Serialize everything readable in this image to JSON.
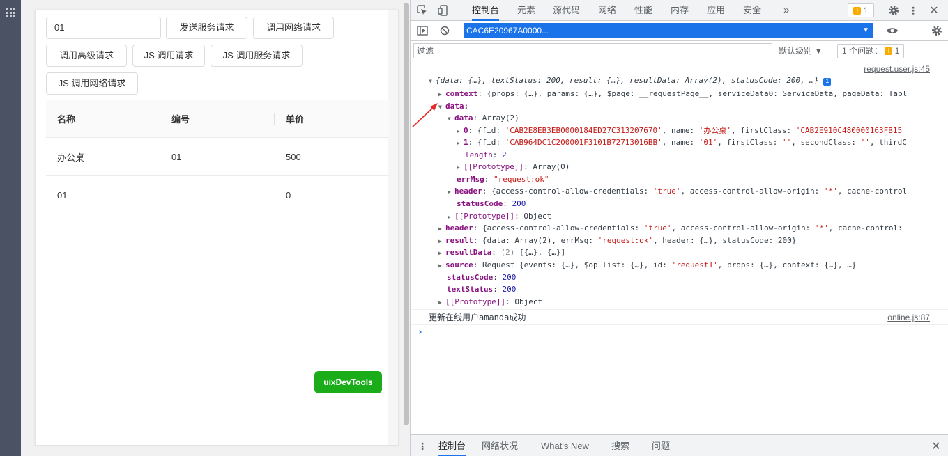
{
  "preview": {
    "input_value": "01",
    "buttons": [
      "发送服务请求",
      "调用网络请求",
      "调用高级请求",
      "JS 调用请求",
      "JS 调用服务请求",
      "JS 调用网络请求"
    ],
    "table": {
      "headers": [
        "名称",
        "编号",
        "单价"
      ],
      "rows": [
        [
          "办公桌",
          "01",
          "500"
        ],
        [
          "01",
          "",
          "0"
        ]
      ]
    },
    "uix_label": "uixDevTools"
  },
  "devtools": {
    "tabs": [
      "控制台",
      "元素",
      "源代码",
      "网络",
      "性能",
      "内存",
      "应用",
      "安全"
    ],
    "more": "»",
    "issue_badge_count": "1",
    "context": "CAC6E20967A0000...",
    "filter_placeholder": "过滤",
    "level": "默认级别 ▼",
    "issues_label": "1 个问题：",
    "issues_count": "1",
    "drawer_tabs": [
      "控制台",
      "网络状况",
      "What's New",
      "搜索",
      "问题"
    ],
    "console": {
      "src1": "request.user.js:45",
      "summary": "{data: {…}, textStatus: 200, result: {…}, resultData: Array(2), statusCode: 200, …}",
      "context_line": "{props: {…}, params: {…}, $page: __requestPage__, serviceData0: ServiceData, pageData: Tabl",
      "data_key": "data:",
      "array_val": "Array(2)",
      "item0_pre": "{fid: ",
      "item0_fid": "'CAB2E8EB3EB0000184ED27C313207670'",
      "item0_mid": ", name: ",
      "item0_name": "'办公桌'",
      "item0_post": ", firstClass: ",
      "item0_fc": "'CAB2E910C480000163FB15",
      "item1_pre": "{fid: ",
      "item1_fid": "'CAB964DC1C200001F3101B72713016BB'",
      "item1_mid": ", name: ",
      "item1_name": "'01'",
      "item1_post": ", firstClass: ",
      "item1_fc": "''",
      "item1_sc_pre": ", secondClass: ",
      "item1_sc": "''",
      "item1_tail": ", thirdC",
      "length_val": "2",
      "proto_array": "Array(0)",
      "errmsg_val": "\"request:ok\"",
      "header_pre": "{access-control-allow-credentials: ",
      "header_true": "'true'",
      "header_mid": ", access-control-allow-origin: ",
      "header_star": "'*'",
      "header_tail": ", cache-control",
      "status_val": "200",
      "proto_obj": "Object",
      "header2_tail": ", cache-control:",
      "result_pre": "{data: Array(2), errMsg: ",
      "result_ok": "'request:ok'",
      "result_post": ", header: {…}, statusCode: 200}",
      "resultdata_len": "(2)",
      "resultdata_val": "[{…}, {…}]",
      "source_pre": "Request {events: {…}, $op_list: {…}, id: ",
      "source_id": "'request1'",
      "source_post": ", props: {…}, context: {…}, …}",
      "statuscode_val": "200",
      "textstatus_val": "200",
      "log_text": "更新在线用户amanda成功",
      "src2": "online.js:87"
    }
  }
}
